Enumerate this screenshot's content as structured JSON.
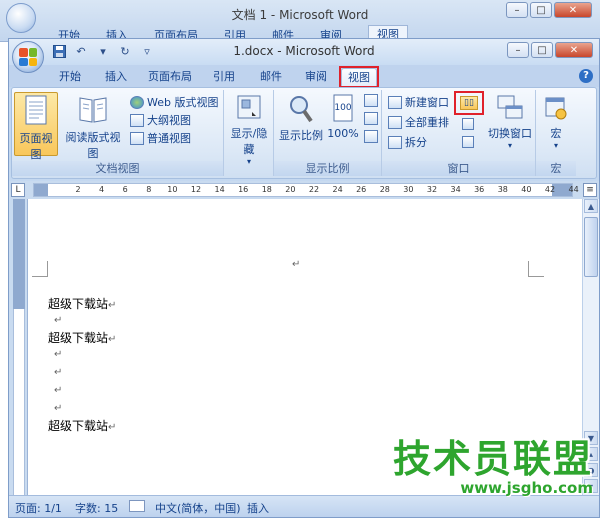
{
  "background_window": {
    "title": "文档 1 - Microsoft Word",
    "tabs": [
      "开始",
      "插入",
      "页面布局",
      "引用",
      "邮件",
      "审阅",
      "视图"
    ]
  },
  "window": {
    "title": "1.docx - Microsoft Word",
    "minimize": "–",
    "maximize": "□",
    "close": "✕"
  },
  "tabs": [
    "开始",
    "插入",
    "页面布局",
    "引用",
    "邮件",
    "审阅",
    "视图"
  ],
  "active_tab": "视图",
  "help": "?",
  "ribbon": {
    "doc_views": {
      "label": "文档视图",
      "page_view": "页面视图",
      "reading_view": "阅读版式视图",
      "web_view": "Web 版式视图",
      "outline": "大纲视图",
      "draft": "普通视图"
    },
    "show_hide": {
      "label": "显示/隐藏"
    },
    "zoom": {
      "label": "显示比例",
      "zoom": "显示比例",
      "percent": "100%"
    },
    "window_group": {
      "label": "窗口",
      "new_window": "新建窗口",
      "arrange_all": "全部重排",
      "split": "拆分",
      "switch_windows": "切换窗口"
    },
    "macros": {
      "label": "宏",
      "button": "宏"
    }
  },
  "ruler_numbers": [
    "2",
    "4",
    "6",
    "8",
    "10",
    "12",
    "14",
    "16",
    "18",
    "20",
    "22",
    "24",
    "26",
    "28",
    "30",
    "32",
    "34",
    "36",
    "38",
    "40",
    "42",
    "44"
  ],
  "document": {
    "paragraphs": [
      "超级下载站",
      "",
      "超级下载站",
      "",
      "",
      "",
      "超级下载站"
    ]
  },
  "status": {
    "page": "页面: 1/1",
    "words": "字数: 15",
    "language": "中文(简体，中国)",
    "insert": "插入"
  },
  "watermark": {
    "name": "技术员联盟",
    "url": "www.jsgho.com"
  },
  "colors": {
    "highlight_box": "#e0212b",
    "ribbon_bg": "#dce8f6",
    "selected_button": "#f9c75b",
    "watermark": "#2ea52e"
  }
}
